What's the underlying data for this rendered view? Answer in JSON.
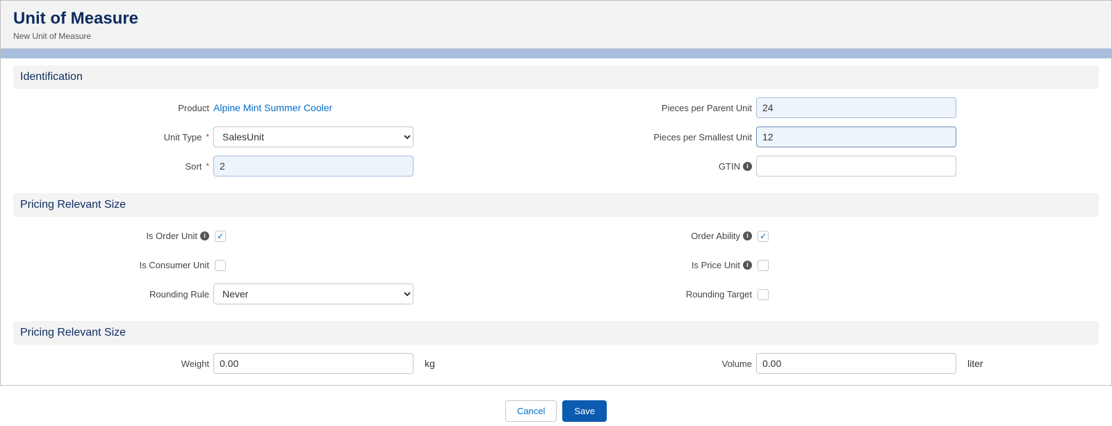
{
  "header": {
    "title": "Unit of Measure",
    "subtitle": "New Unit of Measure"
  },
  "sections": {
    "identification": {
      "title": "Identification",
      "product_label": "Product",
      "product_value": "Alpine Mint Summer Cooler",
      "unit_type_label": "Unit Type",
      "unit_type_value": "SalesUnit",
      "sort_label": "Sort",
      "sort_value": "2",
      "pieces_parent_label": "Pieces per Parent Unit",
      "pieces_parent_value": "24",
      "pieces_smallest_label": "Pieces per Smallest Unit",
      "pieces_smallest_value": "12",
      "gtin_label": "GTIN",
      "gtin_value": ""
    },
    "pricing1": {
      "title": "Pricing Relevant Size",
      "is_order_unit_label": "Is Order Unit",
      "is_order_unit_checked": true,
      "is_consumer_unit_label": "Is Consumer Unit",
      "is_consumer_unit_checked": false,
      "rounding_rule_label": "Rounding Rule",
      "rounding_rule_value": "Never",
      "order_ability_label": "Order Ability",
      "order_ability_checked": true,
      "is_price_unit_label": "Is Price Unit",
      "is_price_unit_checked": false,
      "rounding_target_label": "Rounding Target",
      "rounding_target_checked": false
    },
    "pricing2": {
      "title": "Pricing Relevant Size",
      "weight_label": "Weight",
      "weight_value": "0.00",
      "weight_unit": "kg",
      "volume_label": "Volume",
      "volume_value": "0.00",
      "volume_unit": "liter"
    }
  },
  "actions": {
    "cancel": "Cancel",
    "save": "Save"
  }
}
